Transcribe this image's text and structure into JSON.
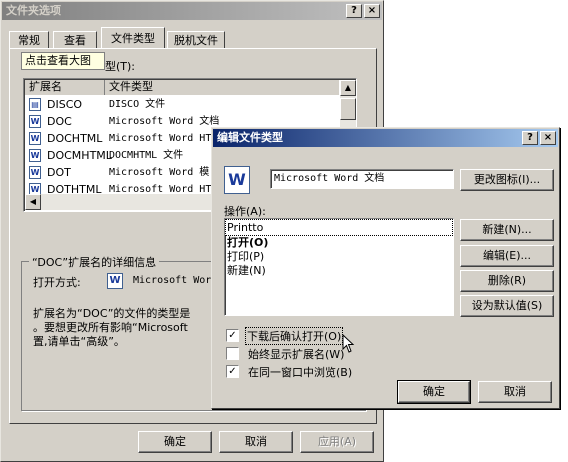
{
  "back": {
    "title": "文件夹选项",
    "help": "?",
    "close": "×",
    "tabs": [
      "常规",
      "查看",
      "文件类型",
      "脱机文件"
    ],
    "tooltip": "点击查看大图",
    "reg_label": "型(T):",
    "col_ext": "扩展名",
    "col_type": "文件类型",
    "rows": [
      {
        "ext": "DISCO",
        "type": "DISCO 文件"
      },
      {
        "ext": "DOC",
        "type": "Microsoft Word 文档"
      },
      {
        "ext": "DOCHTML",
        "type": "Microsoft Word HT"
      },
      {
        "ext": "DOCMHTML",
        "type": "DOCMHTML 文件"
      },
      {
        "ext": "DOT",
        "type": "Microsoft Word 模"
      },
      {
        "ext": "DOTHTML",
        "type": "Microsoft Word HT"
      }
    ],
    "details_title": "“DOC”扩展名的详细信息",
    "open_with_label": "打开方式:",
    "open_with_value": "Microsoft Wor",
    "desc_line1": "扩展名为“DOC”的文件的类型是",
    "desc_line2": "。要想更改所有影响“Microsoft",
    "desc_line3": "置,请单击“高级”。",
    "ok": "确定",
    "cancel": "取消",
    "apply": "应用(A)"
  },
  "dialog": {
    "title": "编辑文件类型",
    "help": "?",
    "close": "×",
    "type_name": "Microsoft Word 文档",
    "change_icon": "更改图标(I)...",
    "actions_label": "操作(A):",
    "actions": [
      "Printto",
      "打开(O)",
      "打印(P)",
      "新建(N)"
    ],
    "new_btn": "新建(N)...",
    "edit_btn": "编辑(E)...",
    "delete_btn": "删除(R)",
    "default_btn": "设为默认值(S)",
    "check1": "下载后确认打开(O)",
    "check2": "始终显示扩展名(W)",
    "check3": "在同一窗口中浏览(B)",
    "check1_checked": "✓",
    "check2_checked": "",
    "check3_checked": "✓",
    "ok": "确定",
    "cancel": "取消"
  }
}
